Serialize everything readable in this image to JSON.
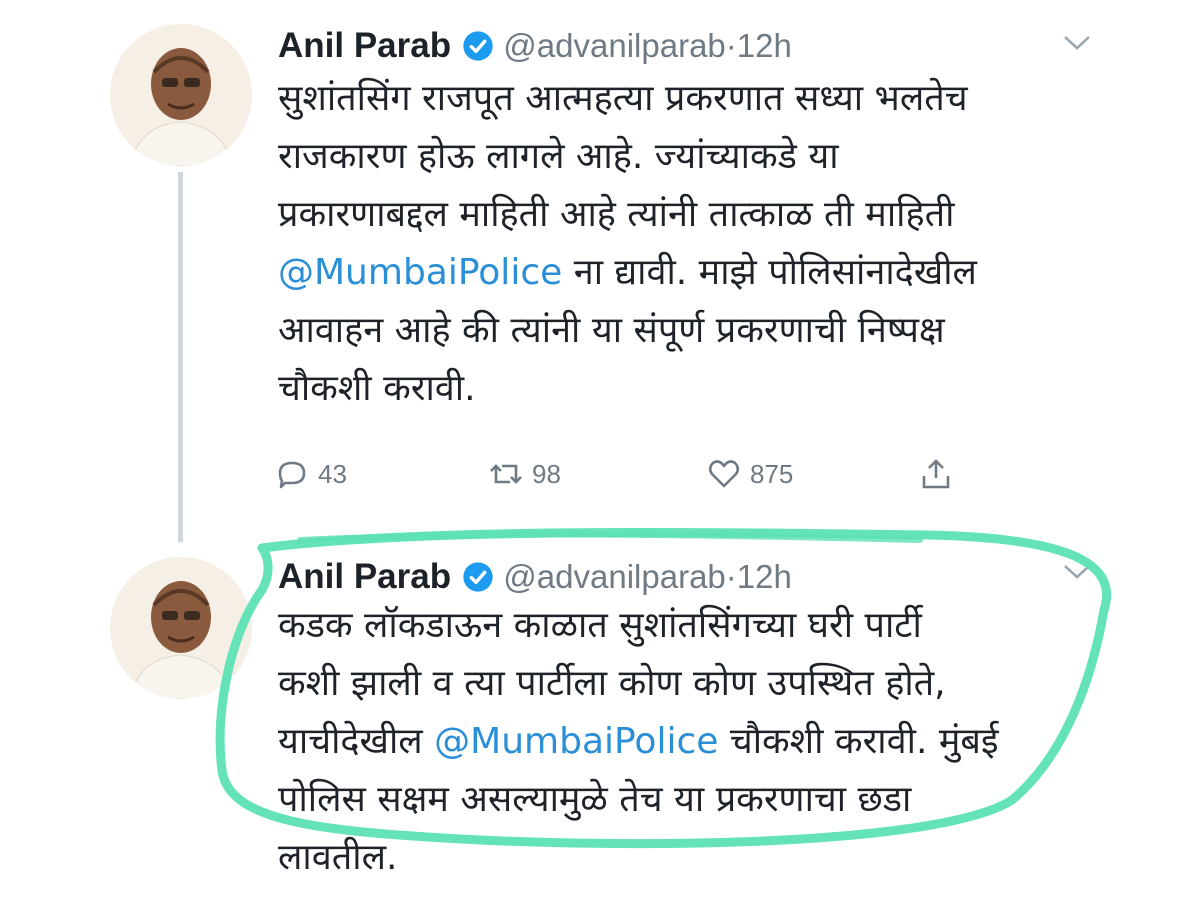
{
  "tweets": [
    {
      "author": {
        "name": "Anil Parab",
        "handle": "@advanilparab",
        "separator": "·",
        "time": "12h"
      },
      "lines": [
        {
          "text": "सुशांतसिंग राजपूत आत्महत्या प्रकरणात सध्या भलतेच"
        },
        {
          "text": "राजकारण होऊ लागले आहे. ज्यांच्याकडे या"
        },
        {
          "text": "प्रकारणाबद्दल माहिती आहे त्यांनी तात्काळ ती माहिती"
        },
        {
          "mention": "@MumbaiPolice",
          "text": " ना द्यावी. माझे पोलिसांनादेखील"
        },
        {
          "text": "आवाहन आहे की त्यांनी या संपूर्ण प्रकरणाची निष्पक्ष"
        },
        {
          "text": "चौकशी करावी."
        }
      ],
      "stats": {
        "replies": "43",
        "retweets": "98",
        "likes": "875"
      }
    },
    {
      "author": {
        "name": "Anil Parab",
        "handle": "@advanilparab",
        "separator": "·",
        "time": "12h"
      },
      "lines": [
        {
          "text": "कडक लॉकडाऊन काळात सुशांतसिंगच्या घरी पार्टी"
        },
        {
          "text": "कशी झाली व त्या पार्टीला कोण कोण उपस्थित होते,"
        },
        {
          "before": "याचीदेखील ",
          "mention": "@MumbaiPolice",
          "text": " चौकशी करावी. मुंबई"
        },
        {
          "text": "पोलिस सक्षम असल्यामुळे तेच या प्रकरणाचा छडा"
        },
        {
          "text": "लावतील."
        }
      ]
    }
  ],
  "icons": {
    "verified": "verified-badge-icon",
    "more": "chevron-down-icon",
    "reply": "comment-icon",
    "retweet": "retweet-icon",
    "like": "heart-icon",
    "share": "share-icon"
  },
  "colors": {
    "mention": "#2a8fd6",
    "verified": "#1d9bf0",
    "highlight": "#5ce1b4",
    "muted": "#6f7a84"
  }
}
